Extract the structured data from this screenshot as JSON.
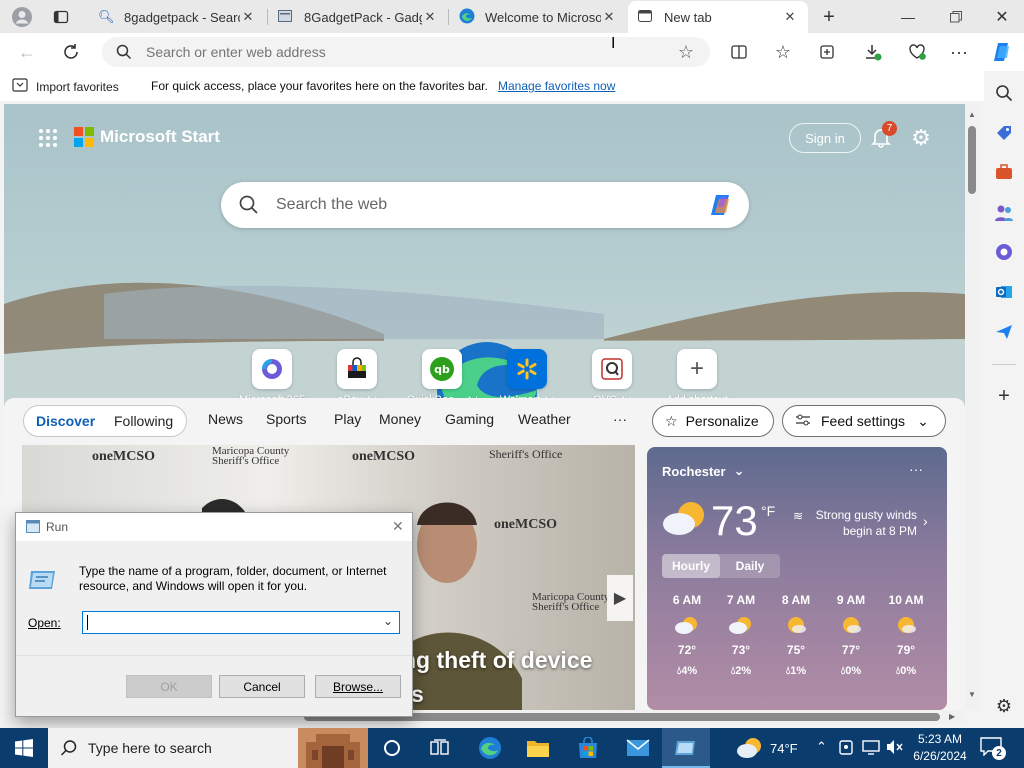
{
  "tabs": [
    {
      "title": "8gadgetpack - Search"
    },
    {
      "title": "8GadgetPack - Gadge"
    },
    {
      "title": "Welcome to Microsoft"
    },
    {
      "title": "New tab"
    }
  ],
  "address_bar": {
    "placeholder": "Search or enter web address"
  },
  "favorites_bar": {
    "import_label": "Import favorites",
    "message": "For quick access, place your favorites here on the favorites bar.",
    "manage_link": "Manage favorites now"
  },
  "page": {
    "brand": "Microsoft Start",
    "sign_in": "Sign in",
    "notification_count": "7",
    "search_placeholder": "Search the web",
    "shortcuts": [
      {
        "label": "Microsoft 365",
        "ad": ""
      },
      {
        "label": "eBay",
        "ad": "Ad"
      },
      {
        "label": "QuickBoo...",
        "ad": "Ad"
      },
      {
        "label": "Walmart",
        "ad": "Ad"
      },
      {
        "label": "QVC",
        "ad": "Ad"
      },
      {
        "label": "Add shortcut",
        "ad": ""
      }
    ],
    "nav": {
      "discover": "Discover",
      "following": "Following",
      "items": [
        "News",
        "Sports",
        "Play",
        "Money",
        "Gaming",
        "Weather"
      ],
      "more": "···",
      "personalize": "Personalize",
      "feed_settings": "Feed settings"
    },
    "hero": {
      "headline_line1": "ng theft of device",
      "headline_line2": "rs",
      "sign_text_1": "oneMCSO",
      "sign_text_2": "Maricopa County",
      "sign_text_3": "Sheriff's Office"
    }
  },
  "weather": {
    "location": "Rochester",
    "temp": "73",
    "unit": "°F",
    "alert_line1": "Strong gusty winds",
    "alert_line2": "begin at 8 PM",
    "tabs": {
      "hourly": "Hourly",
      "daily": "Daily"
    },
    "hours": [
      {
        "time": "6 AM",
        "temp": "72°",
        "precip": "4%"
      },
      {
        "time": "7 AM",
        "temp": "73°",
        "precip": "2%"
      },
      {
        "time": "8 AM",
        "temp": "75°",
        "precip": "1%"
      },
      {
        "time": "9 AM",
        "temp": "77°",
        "precip": "0%"
      },
      {
        "time": "10 AM",
        "temp": "79°",
        "precip": "0%"
      }
    ]
  },
  "run_dialog": {
    "title": "Run",
    "description": "Type the name of a program, folder, document, or Internet resource, and Windows will open it for you.",
    "open_label": "Open:",
    "open_value": "",
    "ok": "OK",
    "cancel": "Cancel",
    "browse": "Browse..."
  },
  "taskbar": {
    "search_placeholder": "Type here to search",
    "weather_temp": "74°F",
    "time": "5:23 AM",
    "date": "6/26/2024",
    "notification_count": "2"
  }
}
